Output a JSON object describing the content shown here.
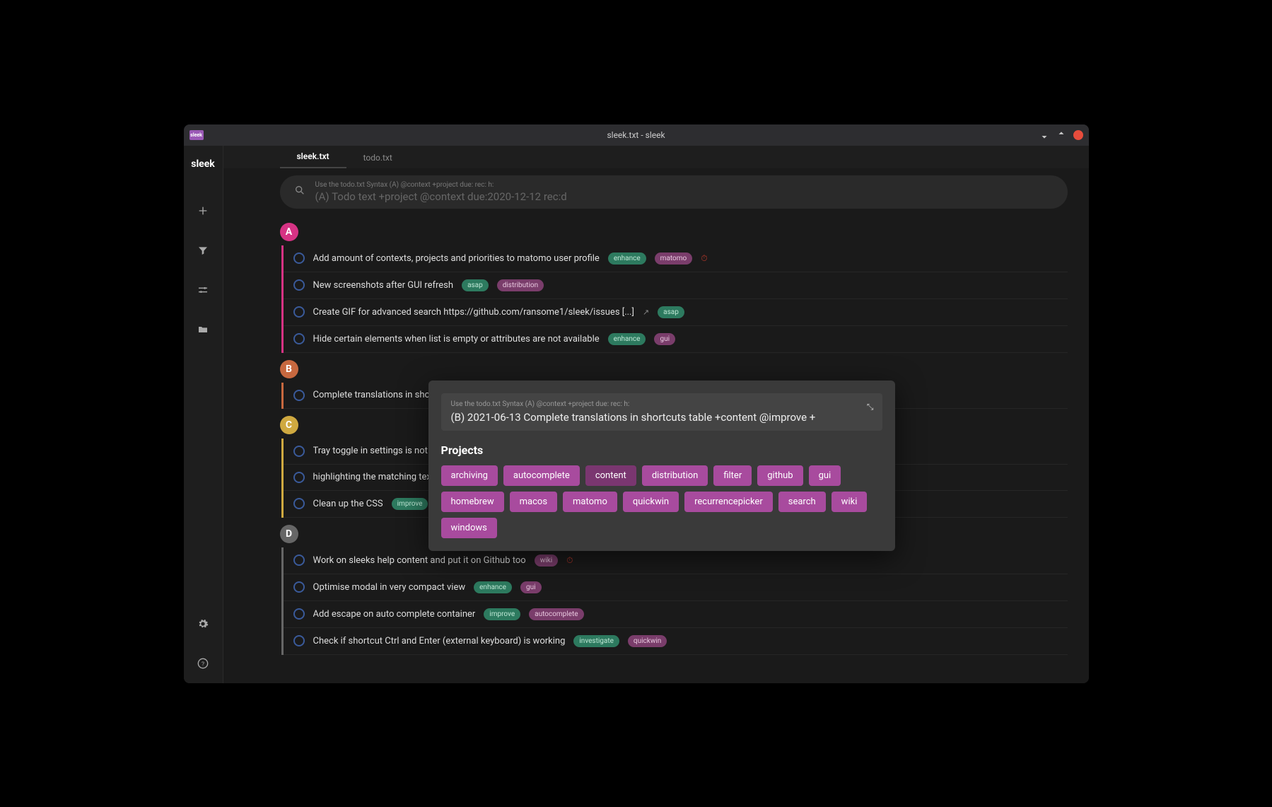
{
  "window_title": "sleek.txt - sleek",
  "app_name": "sleek",
  "tabs": [
    {
      "label": "sleek.txt",
      "active": true
    },
    {
      "label": "todo.txt",
      "active": false
    }
  ],
  "search": {
    "hint": "Use the todo.txt Syntax (A) @context +project due: rec: h:",
    "placeholder": "(A) Todo text +project @context due:2020-12-12 rec:d"
  },
  "groups": [
    {
      "priority": "A",
      "items": [
        {
          "text": "Add amount of contexts, projects and priorities to matomo user profile",
          "contexts": [
            "enhance"
          ],
          "projects": [
            "matomo"
          ],
          "overdue": true
        },
        {
          "text": "New screenshots after GUI refresh",
          "contexts": [
            "asap"
          ],
          "projects": [
            "distribution"
          ]
        },
        {
          "text": "Create GIF for advanced search https://github.com/ransome1/sleek/issues [...]",
          "external": true,
          "contexts": [
            "asap"
          ]
        },
        {
          "text": "Hide certain elements when list is empty or attributes are not available",
          "contexts": [
            "enhance"
          ],
          "projects": [
            "gui"
          ]
        }
      ]
    },
    {
      "priority": "B",
      "items": [
        {
          "text": "Complete translations in shor"
        }
      ]
    },
    {
      "priority": "C",
      "items": [
        {
          "text": "Tray toggle in settings is not o"
        },
        {
          "text": "highlighting the matching text wit"
        },
        {
          "text": "Clean up the CSS",
          "contexts": [
            "improve"
          ]
        }
      ]
    },
    {
      "priority": "D",
      "items": [
        {
          "text": "Work on sleeks help content and put it on Github too",
          "projects": [
            "wiki"
          ],
          "overdue": true
        },
        {
          "text": "Optimise modal in very compact view",
          "contexts": [
            "enhance"
          ],
          "projects": [
            "gui"
          ]
        },
        {
          "text": "Add escape on auto complete container",
          "contexts": [
            "improve"
          ],
          "projects": [
            "autocomplete"
          ]
        },
        {
          "text": "Check if shortcut Ctrl and Enter (external keyboard) is working",
          "contexts": [
            "investigate"
          ],
          "projects": [
            "quickwin"
          ]
        }
      ]
    }
  ],
  "modal": {
    "hint": "Use the todo.txt Syntax (A) @context +project due: rec: h:",
    "value": "(B) 2021-06-13 Complete translations in shortcuts table +content @improve +",
    "section_title": "Projects",
    "chips": [
      "archiving",
      "autocomplete",
      "content",
      "distribution",
      "filter",
      "github",
      "gui",
      "homebrew",
      "macos",
      "matomo",
      "quickwin",
      "recurrencepicker",
      "search",
      "wiki",
      "windows"
    ],
    "selected_chip": "content"
  }
}
